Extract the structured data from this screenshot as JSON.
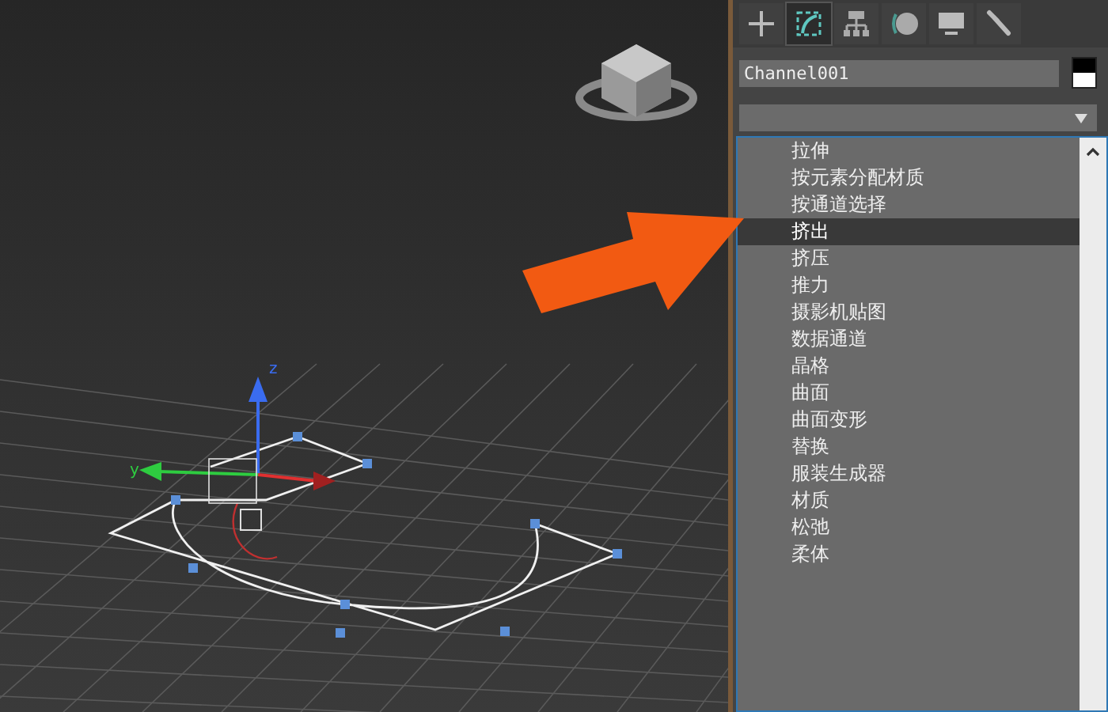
{
  "viewport": {
    "axis_labels": [
      {
        "label": "z",
        "color": "#3a6cf0"
      },
      {
        "label": "y",
        "color": "#2ecc40"
      }
    ]
  },
  "command_tabs": [
    {
      "kind": "create",
      "selected": false
    },
    {
      "kind": "modify",
      "selected": true
    },
    {
      "kind": "hierarchy",
      "selected": false
    },
    {
      "kind": "motion",
      "selected": false
    },
    {
      "kind": "display",
      "selected": false
    },
    {
      "kind": "utilities",
      "selected": false
    }
  ],
  "object_name": "Channel001",
  "modifiers": [
    {
      "label": "拉伸",
      "selected": false
    },
    {
      "label": "按元素分配材质",
      "selected": false
    },
    {
      "label": "按通道选择",
      "selected": false
    },
    {
      "label": "挤出",
      "selected": true
    },
    {
      "label": "挤压",
      "selected": false
    },
    {
      "label": "推力",
      "selected": false
    },
    {
      "label": "摄影机贴图",
      "selected": false
    },
    {
      "label": "数据通道",
      "selected": false
    },
    {
      "label": "晶格",
      "selected": false
    },
    {
      "label": "曲面",
      "selected": false
    },
    {
      "label": "曲面变形",
      "selected": false
    },
    {
      "label": "替换",
      "selected": false
    },
    {
      "label": "服装生成器",
      "selected": false
    },
    {
      "label": "材质",
      "selected": false
    },
    {
      "label": "松弛",
      "selected": false
    },
    {
      "label": "柔体",
      "selected": false
    }
  ]
}
